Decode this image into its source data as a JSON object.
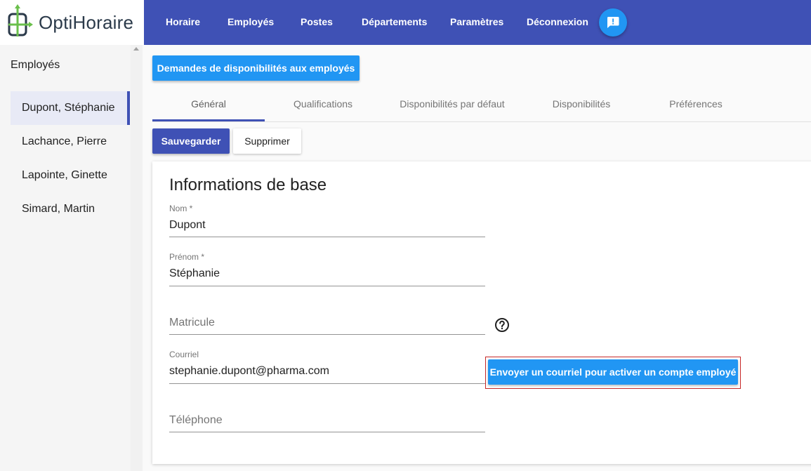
{
  "app": {
    "logo_text": "OptiHoraire"
  },
  "nav": {
    "items": [
      "Horaire",
      "Employés",
      "Postes",
      "Départements",
      "Paramètres",
      "Déconnexion"
    ],
    "chat_icon": "chat-alert-icon"
  },
  "sidebar": {
    "title": "Employés",
    "employees": [
      "Dupont, Stéphanie",
      "Lachance, Pierre",
      "Lapointe, Ginette",
      "Simard, Martin"
    ],
    "selected_index": 0
  },
  "toolbar": {
    "request_label": "Demandes de disponibilités aux employés",
    "save_label": "Sauvegarder",
    "delete_label": "Supprimer"
  },
  "tabs": {
    "items": [
      "Général",
      "Qualifications",
      "Disponibilités par défaut",
      "Disponibilités",
      "Préférences"
    ],
    "active_index": 0
  },
  "form": {
    "section_title": "Informations de base",
    "nom": {
      "label": "Nom *",
      "value": "Dupont"
    },
    "prenom": {
      "label": "Prénom *",
      "value": "Stéphanie"
    },
    "matricule": {
      "placeholder": "Matricule",
      "help_icon": "help-circle-icon"
    },
    "courriel": {
      "label": "Courriel",
      "value": "stephanie.dupont@pharma.com"
    },
    "telephone": {
      "placeholder": "Téléphone"
    },
    "email_button_label": "Envoyer un courriel pour activer un compte employé"
  },
  "colors": {
    "primary": "#3f51b5",
    "accent": "#2196f3",
    "highlight_border": "#c62828",
    "logo_green": "#6abf4b",
    "logo_dark": "#2b3a4a"
  }
}
